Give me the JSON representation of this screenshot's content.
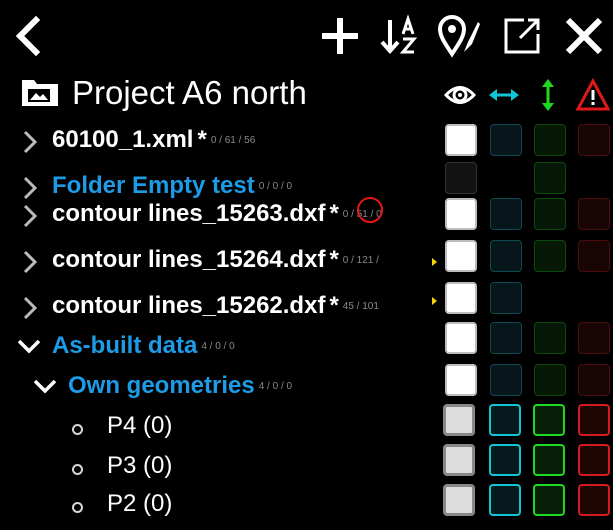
{
  "toolbar": {
    "icons": [
      "back-chevron-icon",
      "plus-icon",
      "sort-a-z-icon",
      "map-marker-edit-icon",
      "open-external-icon",
      "close-icon"
    ]
  },
  "project": {
    "title": "Project A6 north",
    "icon": "folder-image-icon"
  },
  "column_headers": [
    "eye-visibility-icon",
    "horizontal-arrows-icon",
    "vertical-arrows-icon",
    "warning-triangle-icon"
  ],
  "colors": {
    "folder_blue": "#1e9be6",
    "teal": "#12c3d3",
    "green": "#1ed81e",
    "red": "#d41a1a",
    "yellow": "#f2d400"
  },
  "rows": [
    {
      "name": "60100_1.xml",
      "star": "*",
      "counts": "0 / 61 / 56"
    },
    {
      "name": "Folder Empty test",
      "counts": "0 / 0 / 0"
    },
    {
      "name": "contour lines_15263.dxf",
      "star": "*",
      "counts": "0 / 51 / 0"
    },
    {
      "name": "contour lines_15264.dxf",
      "star": "*",
      "counts": "0 / 121 /"
    },
    {
      "name": "contour lines_15262.dxf",
      "star": "*",
      "counts": "45 / 101"
    },
    {
      "name": "As-built data",
      "counts": "4 / 0 / 0"
    },
    {
      "name": "Own geometries",
      "counts": "4 / 0 / 0"
    },
    {
      "name": "P4 (0)"
    },
    {
      "name": "P3 (0)"
    },
    {
      "name": "P2 (0)"
    }
  ]
}
